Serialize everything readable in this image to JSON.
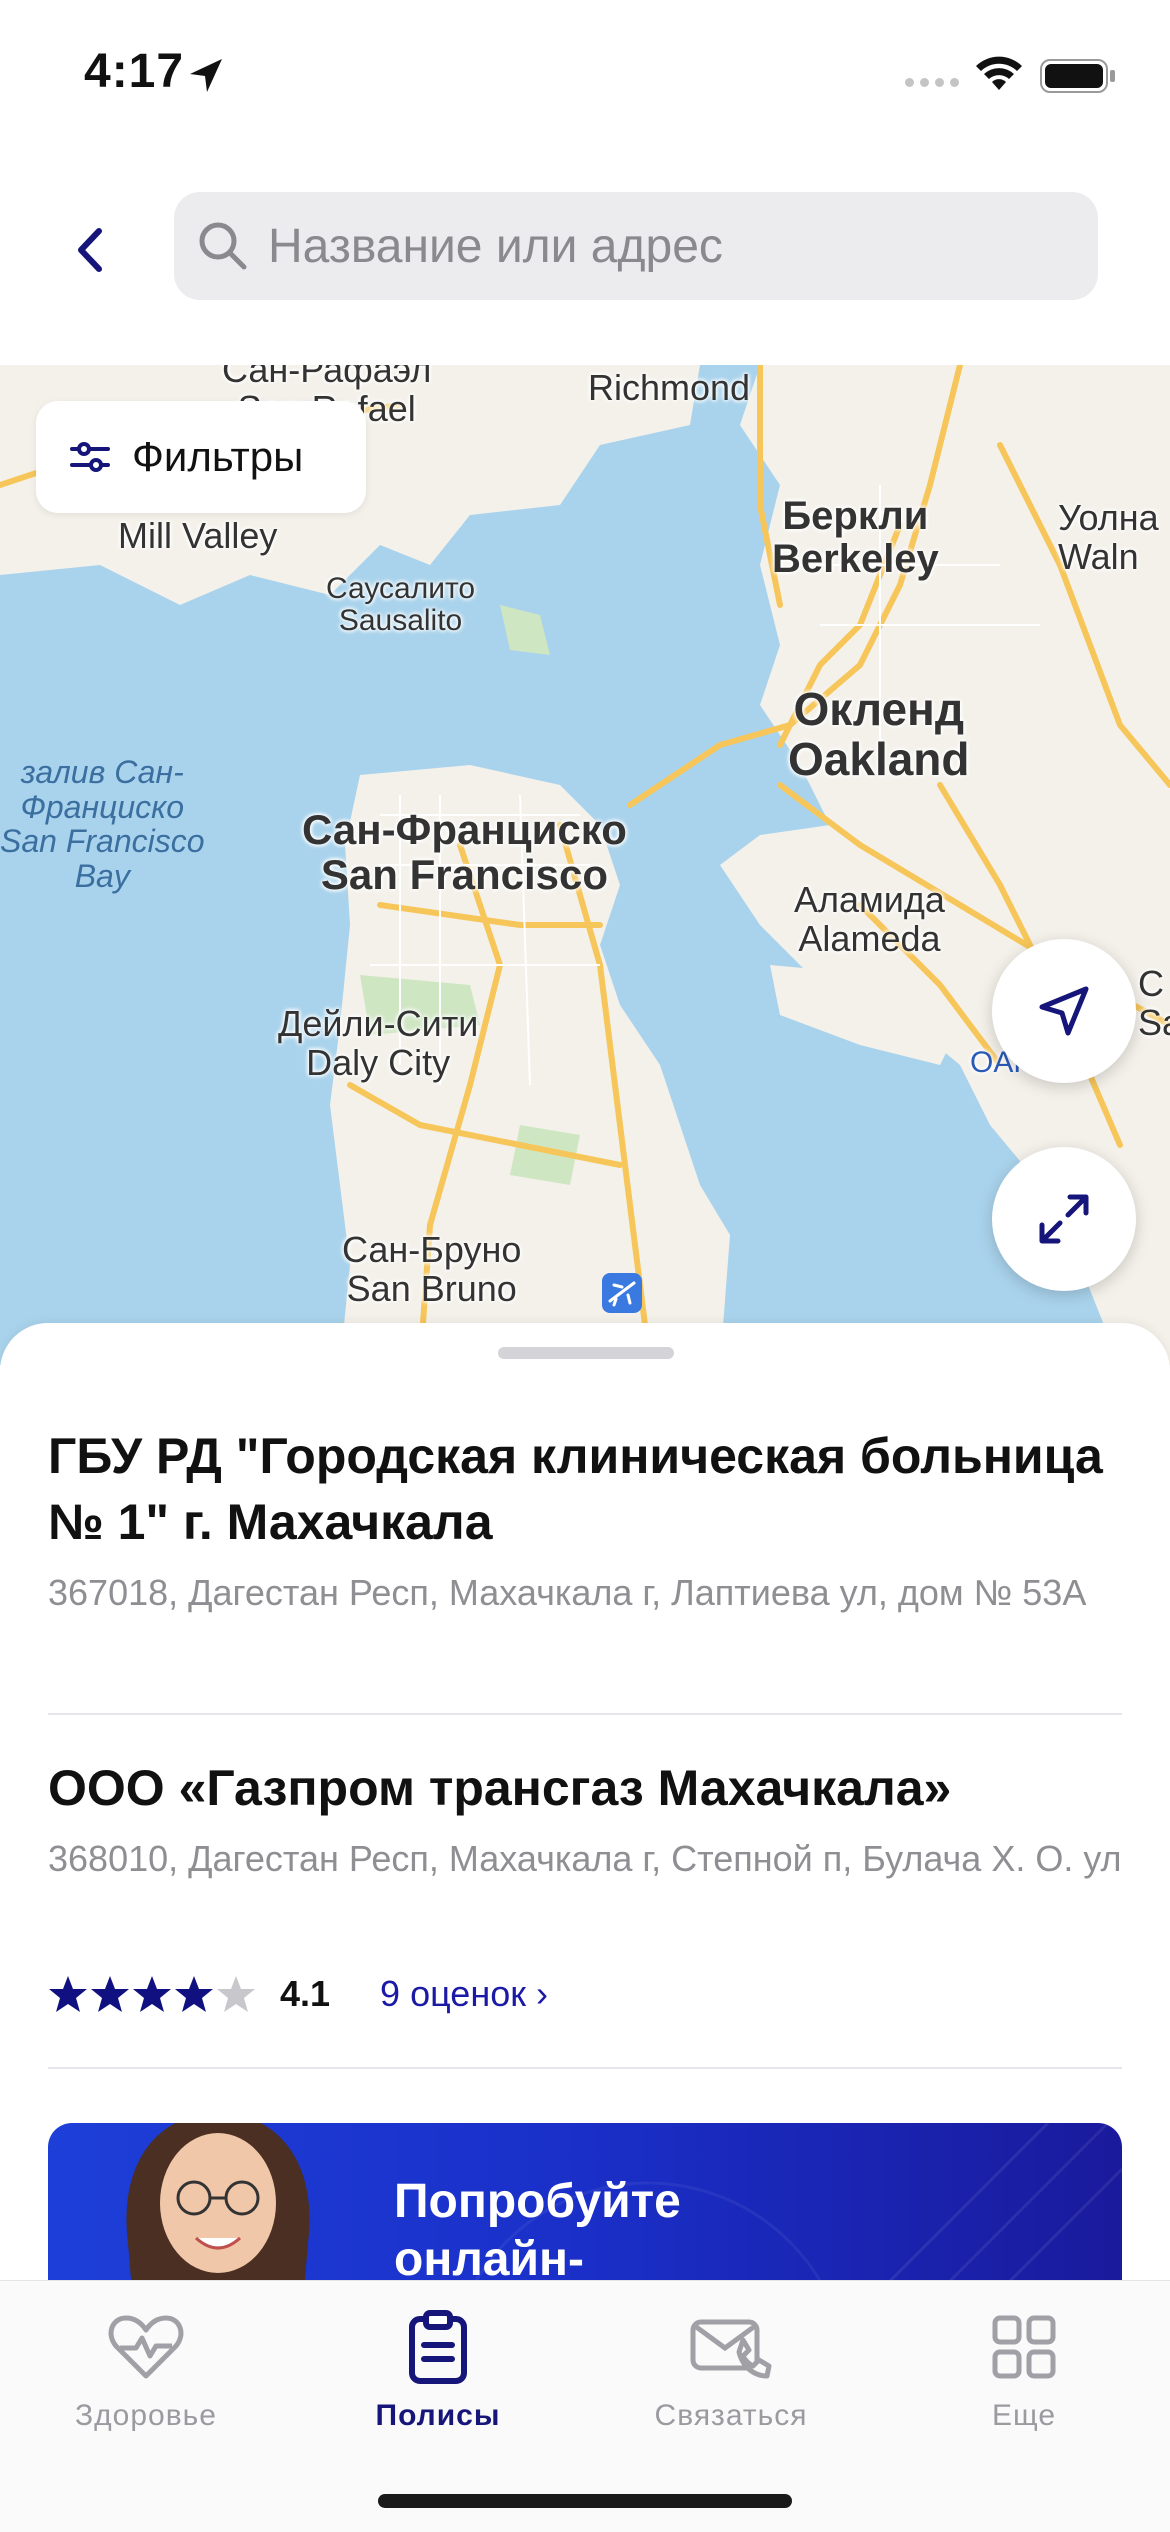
{
  "status_bar": {
    "time": "4:17"
  },
  "header": {
    "search_placeholder": "Название или адрес"
  },
  "map": {
    "filter_label": "Фильтры",
    "labels": {
      "san_rafael_ru": "Сан-Рафаэл",
      "san_rafael_en": "San Rafael",
      "richmond": "Richmond",
      "mill_valley": "Mill Valley",
      "sausalito_ru": "Саусалито",
      "sausalito_en": "Sausalito",
      "berkeley_ru": "Беркли",
      "berkeley_en": "Berkeley",
      "walnut_ru": "Уолна",
      "walnut_en": "Waln",
      "oakland_ru": "Окленд",
      "oakland_en": "Oakland",
      "bay_ru_1": "залив Сан-",
      "bay_ru_2": "Франциско",
      "bay_en_1": "San Francisco",
      "bay_en_2": "Bay",
      "sf_ru": "Сан-Франциско",
      "sf_en": "San Francisco",
      "alameda_ru": "Аламида",
      "alameda_en": "Alameda",
      "daly_ru": "Дейли-Сити",
      "daly_en": "Daly City",
      "oak_airport": "OAK",
      "san_bruno_ru": "Сан-Бруно",
      "san_bruno_en": "San Bruno",
      "edge_c": "С",
      "edge_s": "Sa"
    }
  },
  "organizations": [
    {
      "title": "ГБУ РД \"Городская клиническая больница № 1\" г. Махачкала",
      "address": "367018, Дагестан Респ, Махачкала г, Лаптиева ул, дом № 53А"
    },
    {
      "title": "ООО «Газпром трансгаз Махачкала»",
      "address": "368010, Дагестан Респ, Махачкала г, Степной п, Булача Х. О. ул",
      "rating": "4.1",
      "rating_stars": 4.1,
      "reviews_link": "9 оценок ›"
    }
  ],
  "promo": {
    "title": "Попробуйте онлайн-консультации"
  },
  "tabbar": {
    "tabs": [
      {
        "label": "Здоровье",
        "icon": "heart-pulse-icon"
      },
      {
        "label": "Полисы",
        "icon": "clipboard-icon"
      },
      {
        "label": "Связаться",
        "icon": "envelope-phone-icon"
      },
      {
        "label": "Еще",
        "icon": "grid-icon"
      }
    ]
  },
  "colors": {
    "accent": "#15157a",
    "link": "#1a1aa6",
    "star": "#101080",
    "promo_start": "#1d3fd8",
    "promo_end": "#1a1a9c",
    "water": "#a9d3ec",
    "land": "#f4f1ea",
    "road": "#f7c65a"
  }
}
